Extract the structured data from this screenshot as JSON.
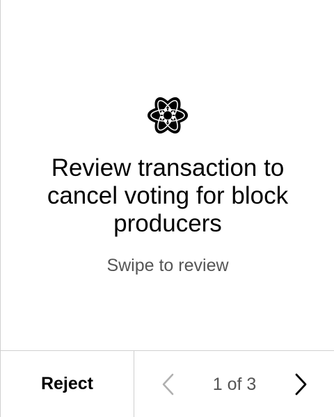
{
  "main": {
    "icon": "atom-icon",
    "title": "Review transaction to cancel voting for block producers",
    "subtitle": "Swipe to review"
  },
  "footer": {
    "reject_label": "Reject",
    "page_indicator": "1 of 3",
    "prev_icon": "chevron-left-icon",
    "next_icon": "chevron-right-icon",
    "current_page": 1,
    "total_pages": 3
  },
  "colors": {
    "text_primary": "#000000",
    "text_secondary": "#555555",
    "divider": "#cfcfcf",
    "disabled_icon": "#b0b0b0"
  }
}
